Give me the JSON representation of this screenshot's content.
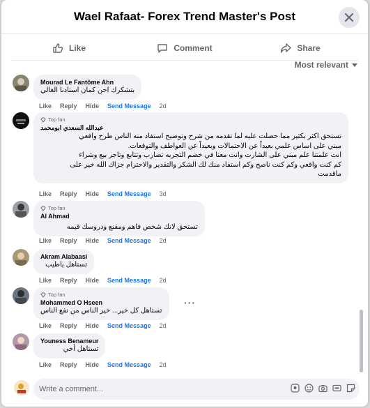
{
  "header": {
    "title": "Wael Rafaat- Forex Trend Master's Post"
  },
  "actions": {
    "like": "Like",
    "comment": "Comment",
    "share": "Share"
  },
  "sort": {
    "label": "Most relevant"
  },
  "badge_label": "Top fan",
  "footer_labels": {
    "like": "Like",
    "reply": "Reply",
    "hide": "Hide",
    "send": "Send Message"
  },
  "comments": [
    {
      "name": "Mourad Le Fantôme Ahn",
      "text": "بتشكرك احن كمان استادنا الغالي",
      "time": "2d"
    },
    {
      "name": "عبدالله السعدي ابومحمد",
      "top_fan": true,
      "text": "تستحق اكثر بكثير مما حصلت عليه لما تقدمه من شرح وتوضيح استفاد منه الناس طرح واقعي\nمبني على اساس علمي بعيداً عن الاحتمالات وبعيداً عن العواطف والتوقعات.\nانت علمتنا علم مبني على الشارت وانت معنا في خضم التجربه تضارب وتتابع وتاجر بيع وشراء\nكم كنت واقعي وكم كنت ناصح وكم استفاد منك لك الشكر والتقدير والاحترام جزاك الله خير على\nماقدمت",
      "time": "3d"
    },
    {
      "name": "Al Ahmad",
      "top_fan": true,
      "text": "تستحق لانك شخص فاهم ومقنع ودروسك قيمه",
      "time": "2d"
    },
    {
      "name": "Akram Alabaasi",
      "text": "تستاهل ياطيب",
      "time": "2d"
    },
    {
      "name": "Mohammed O Hseen",
      "top_fan": true,
      "text": "تستاهل كل خير... خير الناس من نفع الناس",
      "time": "2d"
    },
    {
      "name": "Youness Benameur",
      "text": "تستاهل أخي",
      "time": "2d"
    }
  ],
  "composer": {
    "placeholder": "Write a comment..."
  },
  "colors": {
    "link": "#1877f2",
    "secondary": "#65676b",
    "bubble": "#f0f2f5"
  }
}
